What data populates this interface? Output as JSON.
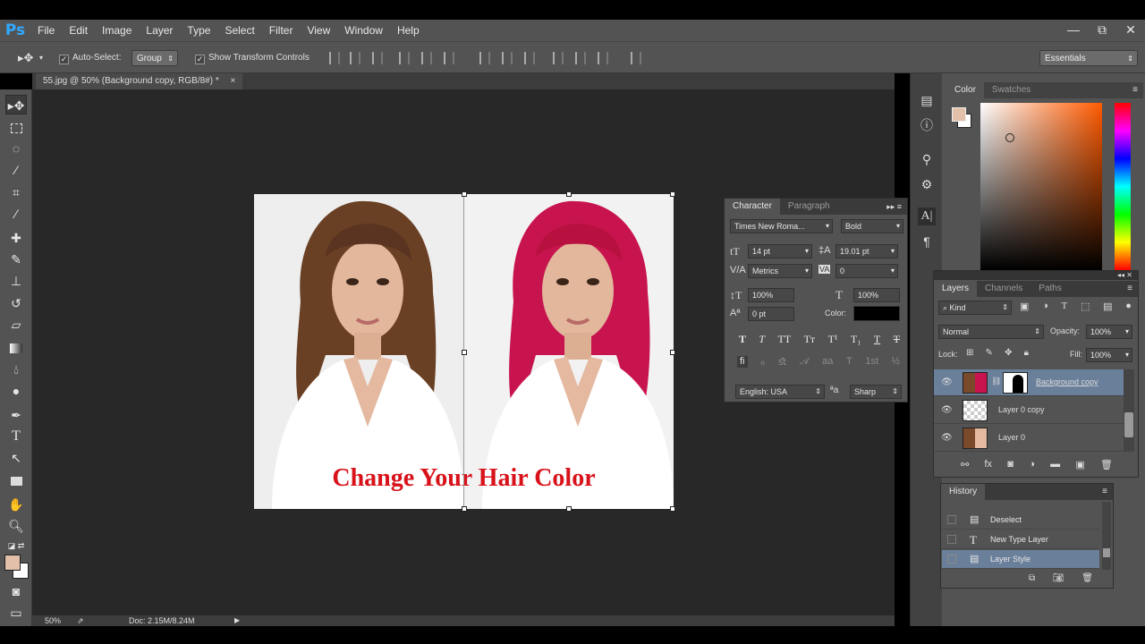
{
  "app": {
    "logo": "Ps",
    "menu": [
      "File",
      "Edit",
      "Image",
      "Layer",
      "Type",
      "Select",
      "Filter",
      "View",
      "Window",
      "Help"
    ]
  },
  "window_controls": {
    "minimize": "—",
    "restore": "⧉",
    "close": "✕"
  },
  "options_bar": {
    "move_icon": "move-tool-icon",
    "auto_select_label": "Auto-Select:",
    "auto_select_value": "Group",
    "transform_controls_label": "Show Transform Controls",
    "workspace": "Essentials"
  },
  "document": {
    "tab_title": "55.jpg @ 50% (Background copy, RGB/8#) *",
    "close": "×"
  },
  "canvas_text": "Change Your Hair Color",
  "status": {
    "zoom": "50%",
    "doc_info": "Doc: 2.15M/8.24M"
  },
  "color_panel": {
    "tabs": [
      "Color",
      "Swatches"
    ],
    "fg_color": "#e3c0aa",
    "bg_color": "#ffffff",
    "picker_hue": "#ff5a00"
  },
  "character_panel": {
    "tabs": [
      "Character",
      "Paragraph"
    ],
    "font_family": "Times New Roma...",
    "font_style": "Bold",
    "font_size": "14 pt",
    "leading": "19.01 pt",
    "kerning": "Metrics",
    "tracking": "0",
    "vertical_scale": "100%",
    "horizontal_scale": "100%",
    "baseline_shift": "0 pt",
    "color_label": "Color:",
    "text_color": "#000000",
    "style_buttons": [
      "T",
      "T",
      "TT",
      "Tт",
      "T¹",
      "T₁",
      "T",
      "T"
    ],
    "ot_buttons": [
      "ﬁ",
      "ℴ",
      "ﬆ",
      "𝒜",
      "aa",
      "T",
      "1st",
      "½"
    ],
    "language": "English: USA",
    "aa_label": "ªa",
    "antialias": "Sharp"
  },
  "layers_panel": {
    "tabs": [
      "Layers",
      "Channels",
      "Paths"
    ],
    "filter": "Kind",
    "blend_mode": "Normal",
    "opacity_label": "Opacity:",
    "opacity": "100%",
    "lock_label": "Lock:",
    "fill_label": "Fill:",
    "fill": "100%",
    "layers": [
      {
        "name": "Background copy",
        "selected": true
      },
      {
        "name": "Layer 0 copy",
        "selected": false
      },
      {
        "name": "Layer 0",
        "selected": false
      }
    ]
  },
  "history_panel": {
    "tab": "History",
    "items": [
      {
        "name": "Deselect",
        "icon": "doc-icon"
      },
      {
        "name": "New Type Layer",
        "icon": "type-icon"
      },
      {
        "name": "Layer Style",
        "icon": "doc-icon"
      }
    ]
  }
}
